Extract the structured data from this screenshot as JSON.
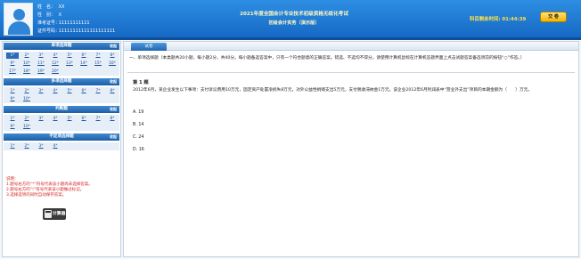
{
  "candidate": {
    "name_label": "姓　名：",
    "name": "XX",
    "gender_label": "性　别：",
    "gender": "X",
    "ticket_label": "准考证号：",
    "ticket": "11111111111",
    "id_label": "证件号码：",
    "id": "11111111111111111111"
  },
  "exam": {
    "title": "2021年度全国会计专业技术初级资格无纸化考试",
    "subject": "初级会计实务（演示版）"
  },
  "timer": {
    "label": "科目剩余时间:",
    "value": "01:44:39"
  },
  "submit_label": "交 卷",
  "sidebar": {
    "sections": [
      {
        "title": "单项选择题",
        "collapse": "收起",
        "rows": [
          [
            "1*",
            "2*",
            "3*",
            "4*",
            "5*",
            "6*",
            "7*",
            "8*"
          ],
          [
            "9*",
            "10*",
            "11*",
            "12*",
            "13*",
            "14*",
            "15*",
            "16*"
          ],
          [
            "17*",
            "18*",
            "19*",
            "20*"
          ]
        ]
      },
      {
        "title": "多项选择题",
        "collapse": "收起",
        "rows": [
          [
            "1*",
            "2*",
            "3*",
            "4*",
            "5*",
            "6*",
            "7*",
            "8*"
          ],
          [
            "9*",
            "10*"
          ]
        ]
      },
      {
        "title": "判断题",
        "collapse": "收起",
        "rows": [
          [
            "1*",
            "2*",
            "3*",
            "4*",
            "5*",
            "6*",
            "7*",
            "8*"
          ],
          [
            "9*",
            "10*"
          ]
        ]
      },
      {
        "title": "不定项选择题",
        "collapse": "收起",
        "rows": [
          [
            "1*",
            "2*",
            "3*",
            "4*"
          ]
        ]
      }
    ],
    "notes": [
      "说明：",
      "1.题号右方的“*”符号代表该小题尚未选择答案。",
      "2.题号右方的“!”符号代表该小题做过标记。",
      "3.选择选项的同时自动保存答案。"
    ],
    "calculator_label": "计算器"
  },
  "main": {
    "tab_label": "试卷",
    "instructions": "一、单项选择题（本类题共20小题，每小题2分，共40分。每小题备选答案中，只有一个符合题意的正确答案。错选、不选均不得分。请使用计算机鼠标在计算机答题界面上点击试题答案备选项前的按钮“○”作答。）",
    "question_title": "第 1 题",
    "question_text": "2012年6月，某企业发生以下事项：支付诉讼费用10万元，固定资产处置净损失8万元，对外公益性捐赠支出5万元，支付税收滞纳金1万元。该企业2012年6月利润表中“营业外支出”项目的本期金额为（　　）万元。",
    "options": [
      "A. 19",
      "B. 14",
      "C. 24",
      "D. 16"
    ]
  }
}
